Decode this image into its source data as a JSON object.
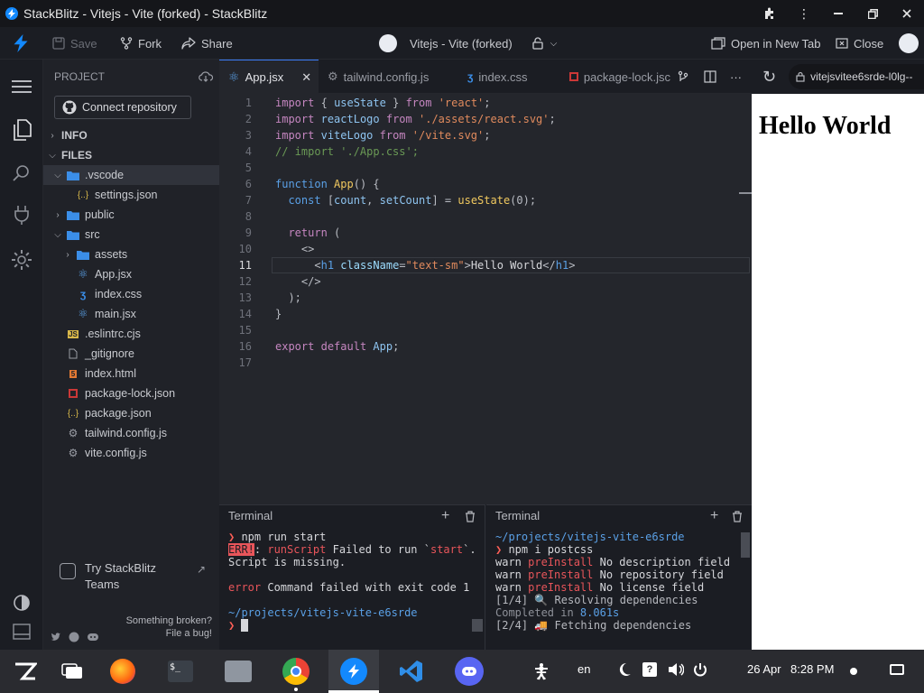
{
  "window": {
    "title": "StackBlitz - Vitejs - Vite (forked) - StackBlitz"
  },
  "header": {
    "save_label": "Save",
    "fork_label": "Fork",
    "share_label": "Share",
    "project_title": "Vitejs - Vite (forked)",
    "open_new_tab_label": "Open in New Tab",
    "close_label": "Close"
  },
  "sidebar": {
    "project_label": "PROJECT",
    "connect_label": "Connect repository",
    "info_label": "INFO",
    "files_label": "FILES",
    "tree": [
      {
        "name": ".vscode",
        "type": "folder",
        "open": true,
        "depth": 0,
        "selected": true
      },
      {
        "name": "settings.json",
        "type": "json",
        "depth": 1
      },
      {
        "name": "public",
        "type": "folder",
        "open": false,
        "depth": 0
      },
      {
        "name": "src",
        "type": "folder",
        "open": true,
        "depth": 0
      },
      {
        "name": "assets",
        "type": "folder",
        "open": false,
        "depth": 1
      },
      {
        "name": "App.jsx",
        "type": "react",
        "depth": 1
      },
      {
        "name": "index.css",
        "type": "css",
        "depth": 1
      },
      {
        "name": "main.jsx",
        "type": "react",
        "depth": 1
      },
      {
        "name": ".eslintrc.cjs",
        "type": "js",
        "depth": 0
      },
      {
        "name": "_gitignore",
        "type": "file",
        "depth": 0
      },
      {
        "name": "index.html",
        "type": "html",
        "depth": 0
      },
      {
        "name": "package-lock.json",
        "type": "npm",
        "depth": 0
      },
      {
        "name": "package.json",
        "type": "json",
        "depth": 0
      },
      {
        "name": "tailwind.config.js",
        "type": "gear",
        "depth": 0
      },
      {
        "name": "vite.config.js",
        "type": "gear",
        "depth": 0
      }
    ],
    "try_teams_line1": "Try StackBlitz",
    "try_teams_line2": "Teams",
    "broken_line1": "Something broken?",
    "broken_line2": "File a bug!"
  },
  "tabs": [
    {
      "label": "App.jsx",
      "active": true
    },
    {
      "label": "tailwind.config.js",
      "active": false
    },
    {
      "label": "index.css",
      "active": false
    },
    {
      "label": "package-lock.jsc",
      "active": false
    }
  ],
  "preview": {
    "url": "vitejsvitee6srde-l0lg--",
    "heading": "Hello World"
  },
  "editor": {
    "current_line": 11,
    "line_numbers": [
      "1",
      "2",
      "3",
      "4",
      "5",
      "6",
      "7",
      "8",
      "9",
      "10",
      "11",
      "12",
      "13",
      "14",
      "15",
      "16",
      "17"
    ]
  },
  "terminal_left": {
    "title": "Terminal",
    "lines": [
      "❯ npm run start",
      "ERR!: runScript Failed to run `start`.",
      "Script is missing.",
      "",
      "error Command failed with exit code 1",
      "",
      "~/projects/vitejs-vite-e6srde",
      "❯ "
    ]
  },
  "terminal_right": {
    "title": "Terminal",
    "lines": [
      "~/projects/vitejs-vite-e6srde",
      "❯ npm i postcss",
      "warn preInstall No description field",
      "warn preInstall No repository field",
      "warn preInstall No license field",
      "[1/4] 🔍 Resolving dependencies",
      "Completed in 8.061s",
      "[2/4] 🚚 Fetching dependencies"
    ]
  },
  "taskbar": {
    "lang": "en",
    "date": "26 Apr",
    "time": "8:28 PM"
  },
  "colors": {
    "accent": "#1389fd",
    "error_bg": "#e8555a",
    "prompt": "#ff5f57"
  }
}
